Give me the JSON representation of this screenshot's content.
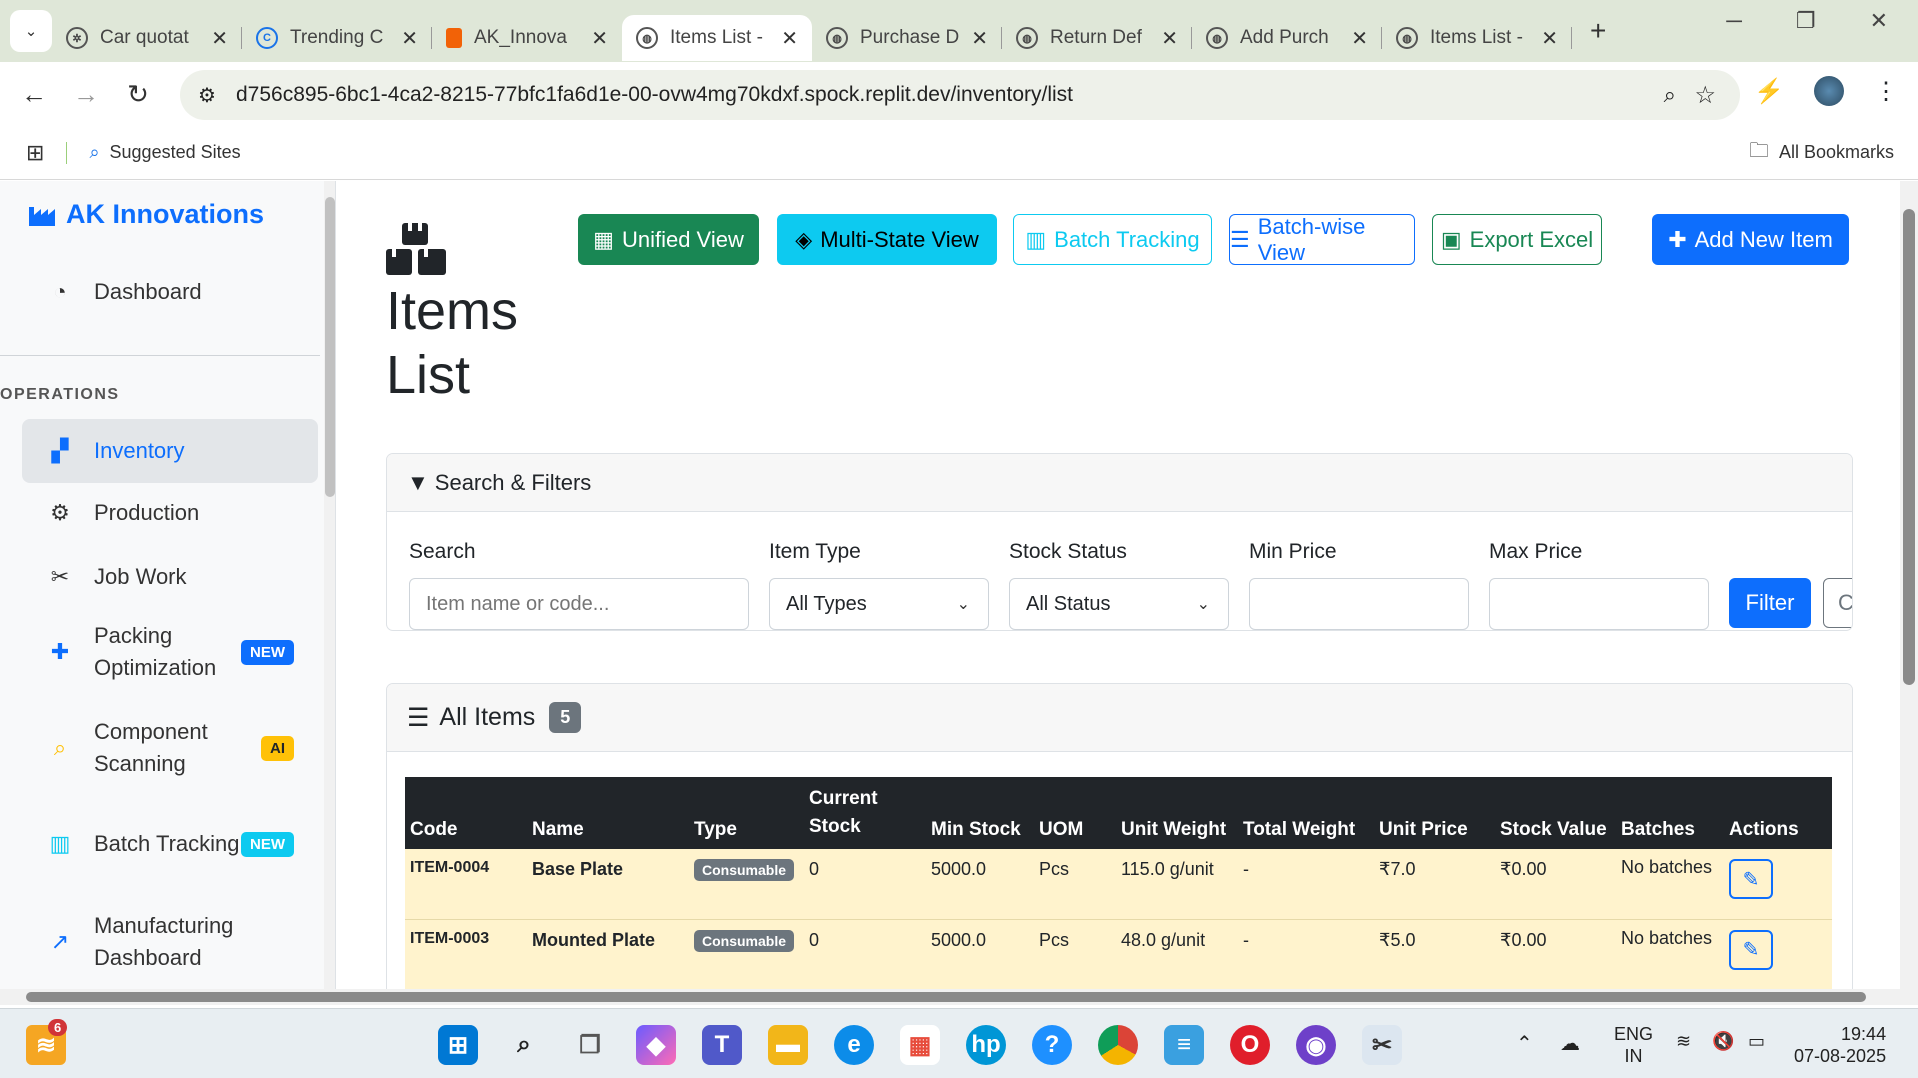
{
  "browser": {
    "tabs": [
      {
        "title": "Car quotat",
        "fav": "openai-icon"
      },
      {
        "title": "Trending C",
        "fav": "c-icon"
      },
      {
        "title": "AK_Innova",
        "fav": "replit-icon"
      },
      {
        "title": "Items List -",
        "fav": "globe-icon",
        "active": true
      },
      {
        "title": "Purchase D",
        "fav": "globe-icon"
      },
      {
        "title": "Return Def",
        "fav": "globe-icon"
      },
      {
        "title": "Add Purch",
        "fav": "globe-icon"
      },
      {
        "title": "Items List -",
        "fav": "globe-icon"
      }
    ],
    "url": "d756c895-6bc1-4ca2-8215-77bfc1fa6d1e-00-ovw4mg70kdxf.spock.replit.dev/inventory/list",
    "bookmarks": {
      "suggested": "Suggested Sites",
      "all": "All Bookmarks"
    }
  },
  "sidebar": {
    "brand": "AK Innovations",
    "dashboard": "Dashboard",
    "section": "OPERATIONS",
    "items": [
      {
        "label": "Inventory",
        "icon": "cubes-icon",
        "active": true
      },
      {
        "label": "Production",
        "icon": "cogs-icon"
      },
      {
        "label": "Job Work",
        "icon": "tools-icon"
      },
      {
        "label": "Packing Optimization",
        "icon": "puzzle-icon",
        "badge": "NEW"
      },
      {
        "label": "Component Scanning",
        "icon": "search-icon",
        "badge": "AI"
      },
      {
        "label": "Batch Tracking",
        "icon": "barcode-icon",
        "badge": "NEW"
      },
      {
        "label": "Manufacturing Dashboard",
        "icon": "chart-line-icon"
      }
    ]
  },
  "page": {
    "title": "Items List",
    "toolbar": {
      "unified": "Unified View",
      "multistate": "Multi-State View",
      "batch": "Batch Tracking",
      "batchwise": "Batch-wise View",
      "export": "Export Excel",
      "add": "Add New Item"
    },
    "filters": {
      "header": "Search & Filters",
      "search_label": "Search",
      "search_placeholder": "Item name or code...",
      "type_label": "Item Type",
      "type_value": "All Types",
      "status_label": "Stock Status",
      "status_value": "All Status",
      "min_label": "Min Price",
      "max_label": "Max Price",
      "filter_btn": "Filter",
      "clear_btn": "Clear"
    },
    "items": {
      "header": "All Items",
      "count": "5",
      "columns": [
        "Code",
        "Name",
        "Type",
        "Current Stock",
        "Min Stock",
        "UOM",
        "Unit Weight",
        "Total Weight",
        "Unit Price",
        "Stock Value",
        "Batches",
        "Actions"
      ],
      "rows": [
        {
          "code": "ITEM-0004",
          "name": "Base Plate",
          "type": "Consumable",
          "current": "0",
          "min": "5000.0",
          "uom": "Pcs",
          "unit_weight": "115.0 g/unit",
          "total_weight": "-",
          "unit_price": "₹7.0",
          "stock_value": "₹0.00",
          "batches": "No batches"
        },
        {
          "code": "ITEM-0003",
          "name": "Mounted Plate",
          "type": "Consumable",
          "current": "0",
          "min": "5000.0",
          "uom": "Pcs",
          "unit_weight": "48.0 g/unit",
          "total_weight": "-",
          "unit_price": "₹5.0",
          "stock_value": "₹0.00",
          "batches": "No batches"
        }
      ]
    }
  },
  "taskbar": {
    "lang": "ENG",
    "region": "IN",
    "time": "19:44",
    "date": "07-08-2025",
    "notif_count": "6"
  },
  "colors": {
    "primary": "#0d6efd",
    "success": "#198754",
    "info": "#0dcaf0",
    "dark": "#212529",
    "warning_row": "#fff3cd"
  }
}
